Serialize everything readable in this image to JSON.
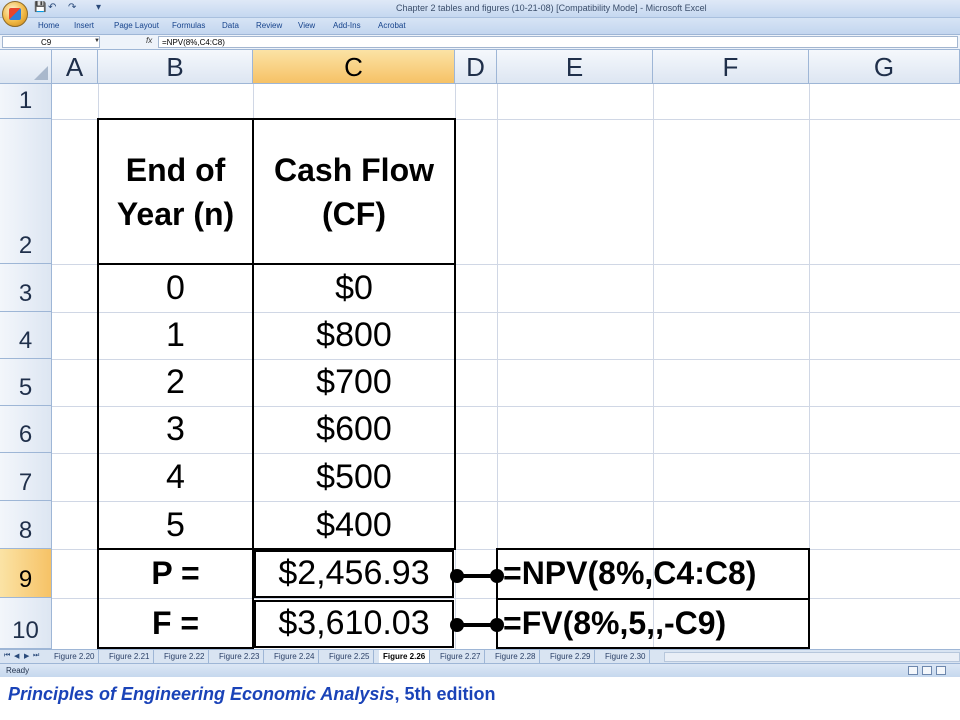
{
  "window": {
    "title": "Chapter 2 tables and figures (10-21-08)  [Compatibility Mode] - Microsoft Excel"
  },
  "ribbon": {
    "tabs": [
      "Home",
      "Insert",
      "Page Layout",
      "Formulas",
      "Data",
      "Review",
      "View",
      "Add-Ins",
      "Acrobat"
    ]
  },
  "formula_bar": {
    "name_box": "C9",
    "fx": "fx",
    "formula": "=NPV(8%,C4:C8)"
  },
  "columns": [
    "A",
    "B",
    "C",
    "D",
    "E",
    "F",
    "G"
  ],
  "rows": [
    "1",
    "2",
    "3",
    "4",
    "5",
    "6",
    "7",
    "8",
    "9",
    "10"
  ],
  "selected_cell": {
    "column": "C",
    "row": "9"
  },
  "table": {
    "header_year_line1": "End of",
    "header_year_line2": "Year (n)",
    "header_cf_line1": "Cash Flow",
    "header_cf_line2": "(CF)",
    "years": [
      "0",
      "1",
      "2",
      "3",
      "4",
      "5"
    ],
    "cash_flows": [
      "$0",
      "$800",
      "$700",
      "$600",
      "$500",
      "$400"
    ],
    "p_label": "P =",
    "p_value": "$2,456.93",
    "p_formula": "=NPV(8%,C4:C8)",
    "f_label": "F =",
    "f_value": "$3,610.03",
    "f_formula": "=FV(8%,5,,-C9)"
  },
  "sheet_tabs": {
    "tabs": [
      "Figure 2.20",
      "Figure 2.21",
      "Figure 2.22",
      "Figure 2.23",
      "Figure 2.24",
      "Figure 2.25",
      "Figure 2.26",
      "Figure 2.27",
      "Figure 2.28",
      "Figure 2.29",
      "Figure 2.30"
    ],
    "active": "Figure 2.26"
  },
  "status_bar": {
    "text": "Ready"
  },
  "caption": {
    "title_italic": "Principles of Engineering Economic Analysis",
    "rest": ", 5th edition"
  }
}
